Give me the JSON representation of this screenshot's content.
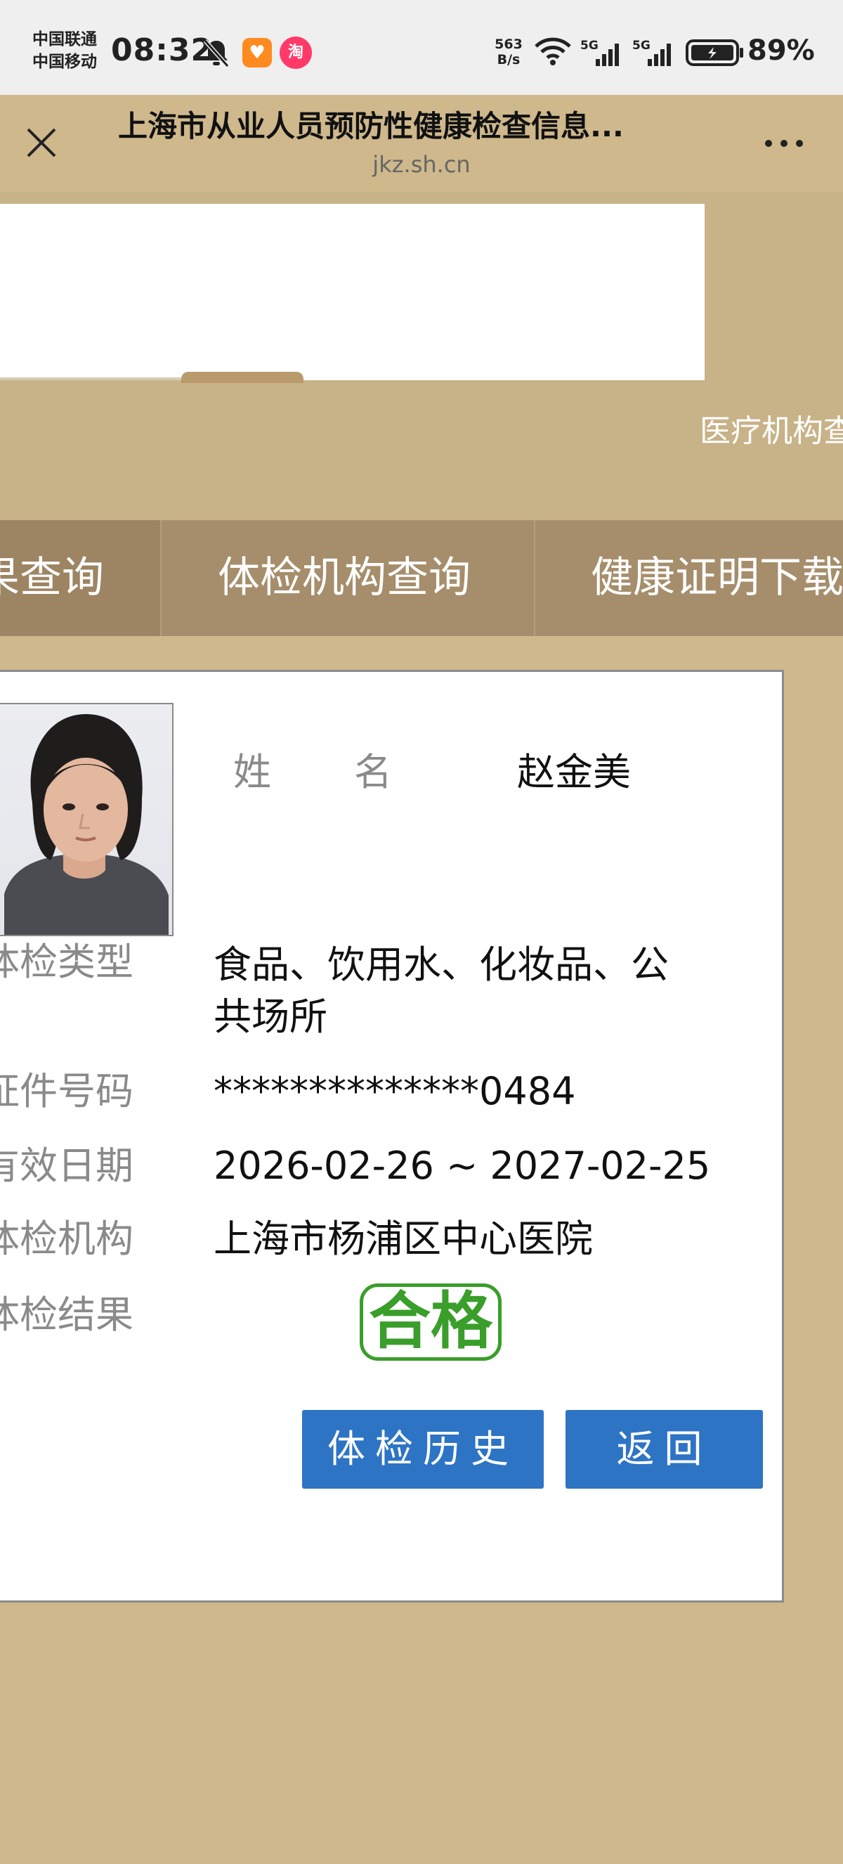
{
  "status_bar": {
    "carrier_1": "中国联通",
    "carrier_2": "中国移动",
    "time": "08:32",
    "net_speed_value": "563",
    "net_speed_unit": "B/s",
    "signal_1_label": "5G",
    "signal_2_label": "5G",
    "battery": "89%",
    "taobao_badge": "淘",
    "icons": [
      "bell-off-icon",
      "app-notification-icon",
      "taobao-icon",
      "wifi-icon",
      "signal-icon",
      "battery-icon"
    ]
  },
  "browser": {
    "title": "上海市从业人员预防性健康检查信息...",
    "url": "jkz.sh.cn"
  },
  "banner": {
    "marquee_text": "医疗机构查询"
  },
  "nav": {
    "items": [
      {
        "label": "结果查询"
      },
      {
        "label": "体检机构查询"
      },
      {
        "label": "健康证明下载"
      }
    ]
  },
  "card": {
    "name_label_1": "姓",
    "name_label_2": "名",
    "name_value": "赵金美",
    "fields": [
      {
        "label": "体检类型",
        "value": "食品、饮用水、化妆品、公共场所"
      },
      {
        "label": "证件号码",
        "value": "**************0484"
      },
      {
        "label": "有效日期",
        "value": "2026-02-26 ~ 2027-02-25"
      },
      {
        "label": "体检机构",
        "value": "上海市杨浦区中心医院"
      },
      {
        "label": "体检结果",
        "value": "合格"
      }
    ],
    "buttons": {
      "history": "体检历史",
      "back": "返回"
    },
    "result_color": "#3a9e2a",
    "button_color": "#2e74c4"
  },
  "theme": {
    "page_background": "#ceb88c",
    "nav_background": "#a68e6c"
  }
}
